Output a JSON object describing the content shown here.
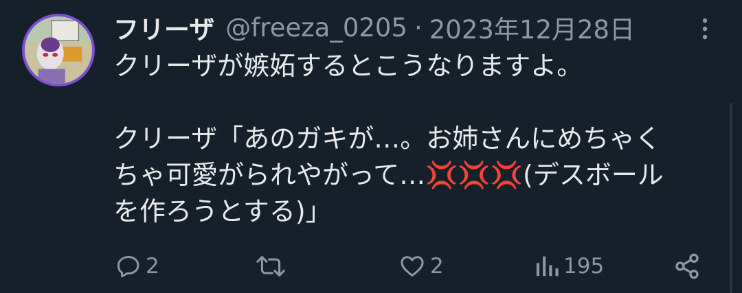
{
  "tweet": {
    "author_name": "フリーザ",
    "handle": "@freeza_0205",
    "separator": "·",
    "date": "2023年12月28日",
    "text": "クリーザが嫉妬するとこうなりますよ。\n\nクリーザ「あのガキが…。お姉さんにめちゃく\nちゃ可愛がられやがって…💢💢💢(デスボール\nを作ろうとする)」",
    "more_icon": "more-vertical-icon"
  },
  "actions": {
    "reply": {
      "icon": "reply-icon",
      "count": "2"
    },
    "retweet": {
      "icon": "retweet-icon",
      "count": ""
    },
    "like": {
      "icon": "heart-icon",
      "count": "2"
    },
    "views": {
      "icon": "views-icon",
      "count": "195"
    },
    "share": {
      "icon": "share-icon"
    }
  },
  "colors": {
    "background": "#15202b",
    "text_primary": "#e7e9ea",
    "text_secondary": "#8b98a5",
    "avatar_border": "#7d4fd0"
  }
}
